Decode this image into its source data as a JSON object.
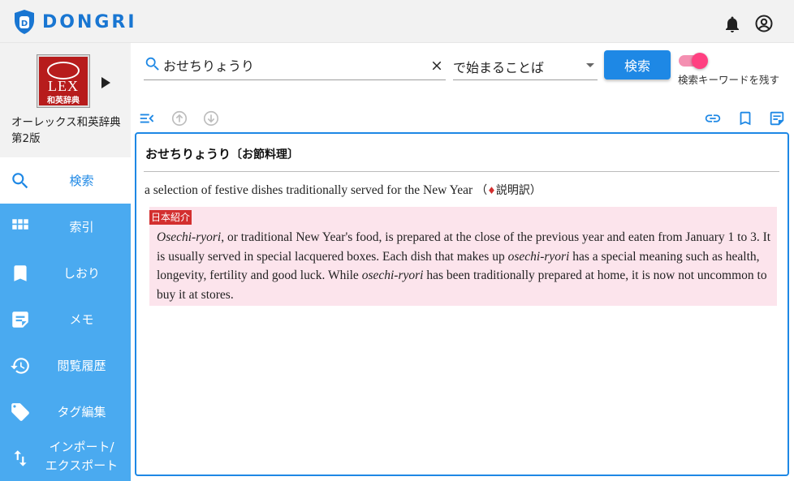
{
  "app": {
    "name": "DONGRI",
    "brand_color": "#1976d2"
  },
  "header": {
    "icons": [
      "bell-icon",
      "account-circle-icon"
    ]
  },
  "sidebar": {
    "dictionary": {
      "logo_word": "LEX",
      "logo_sub": "和英辞典",
      "title_line1": "オーレックス和英辞典",
      "title_line2": "第2版"
    },
    "items": [
      {
        "label": "検索",
        "icon": "search-icon",
        "active": true
      },
      {
        "label": "索引",
        "icon": "grid-icon",
        "active": false
      },
      {
        "label": "しおり",
        "icon": "bookmark-icon",
        "active": false
      },
      {
        "label": "メモ",
        "icon": "memo-icon",
        "active": false
      },
      {
        "label": "閲覧履歴",
        "icon": "history-icon",
        "active": false
      },
      {
        "label": "タグ編集",
        "icon": "tag-icon",
        "active": false
      },
      {
        "label_line1": "インポート/",
        "label_line2": "エクスポート",
        "icon": "import-export-icon",
        "active": false
      }
    ],
    "colors": {
      "nav_bg": "#4aaaf0",
      "active_text": "#1e88e5"
    }
  },
  "search": {
    "query": "おせちりょうり",
    "mode": "で始まることば",
    "button_label": "検索",
    "keep_keyword_label": "検索キーワードを残す",
    "keep_keyword_on": true,
    "toggle_color": "#ff4081"
  },
  "toolbar": {
    "left_icons": [
      "collapse-list-icon",
      "arrow-up-circle-icon",
      "arrow-down-circle-icon"
    ],
    "right_icons": [
      "link-icon",
      "bookmark-outline-icon",
      "memo-outline-icon"
    ]
  },
  "entry": {
    "headword": "おせちりょうり",
    "headword_kanji": "〔お節料理〕",
    "gloss": "a selection of festive dishes traditionally served for the New Year",
    "gloss_note_open": "（",
    "gloss_note_mark": "♦",
    "gloss_note": "説明訳",
    "gloss_note_close": "）",
    "note_tag": "日本紹介",
    "note": {
      "s1_term": "Osechi-ryori",
      "s1_rest": ", or traditional New Year's food, is prepared at the close of the previous year and eaten from January 1 to 3. It is usually served in special lacquered boxes. Each dish that makes up ",
      "s2_term": "osechi-ryori",
      "s2_rest": " has a special meaning such as health, longevity, fertility and good luck. While ",
      "s3_term": "osechi-ryori",
      "s3_rest": " has been traditionally prepared at home, it is now not uncommon to buy it at stores."
    },
    "note_bg": "#fce4ec",
    "tag_color": "#d32f2f"
  }
}
